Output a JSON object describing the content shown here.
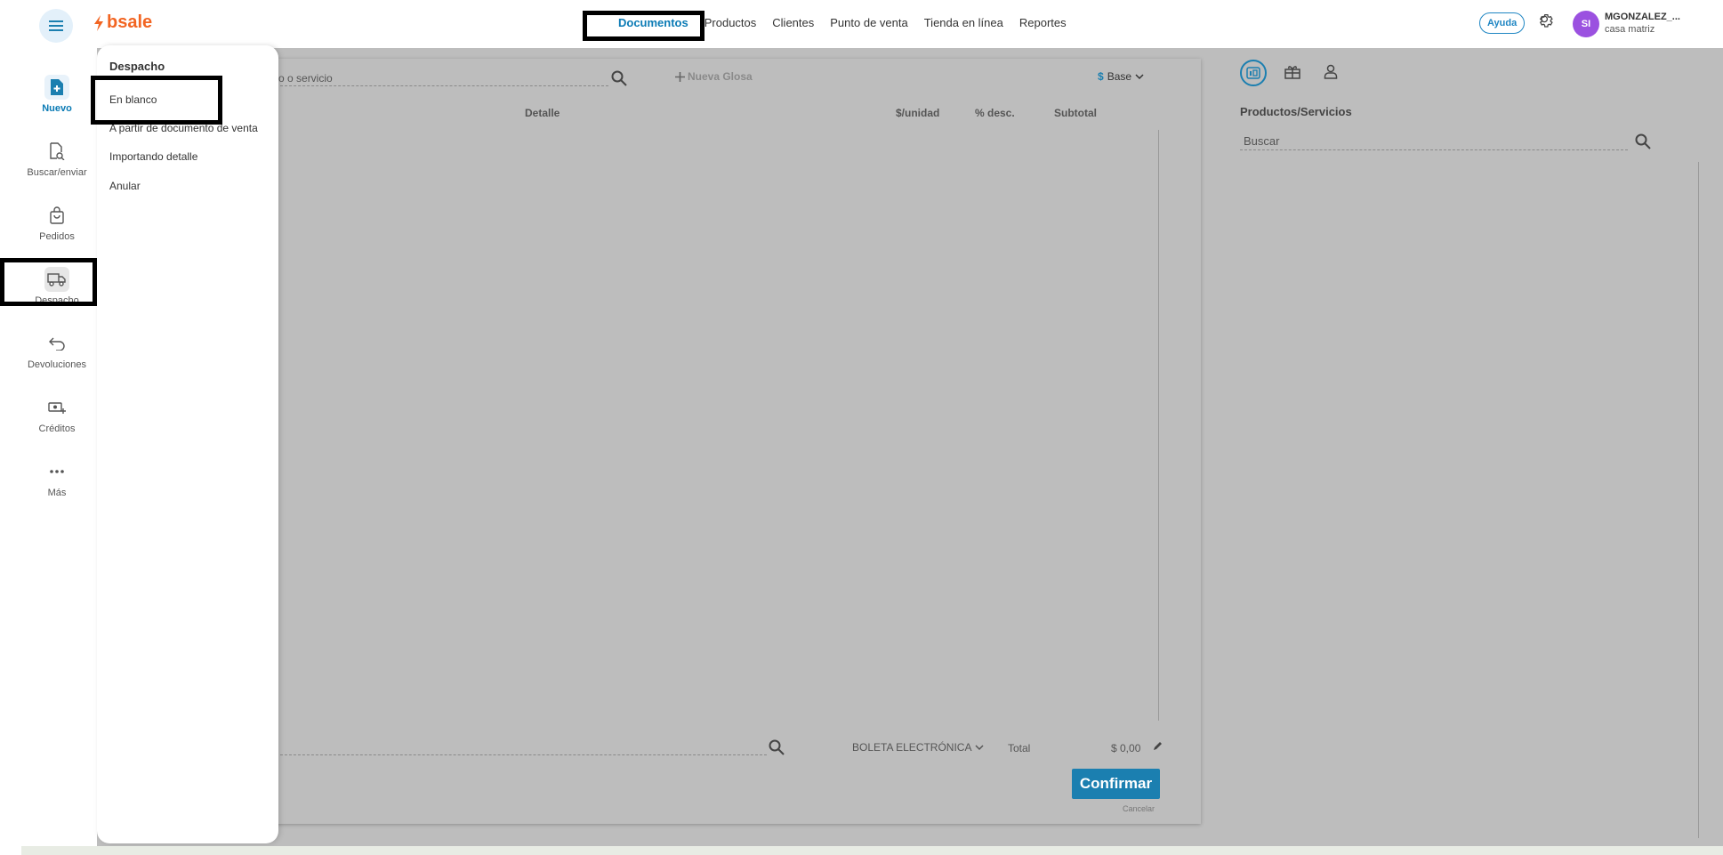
{
  "header": {
    "logo_text": "bsale",
    "nav": [
      "Documentos",
      "Productos",
      "Clientes",
      "Punto de venta",
      "Tienda en línea",
      "Reportes"
    ],
    "help_label": "Ayuda",
    "avatar_initials": "SI",
    "user_name": "MGONZALEZ_...",
    "user_branch": "casa matriz"
  },
  "sidebar": {
    "items": [
      {
        "label": "Nuevo",
        "icon": "new-document-icon"
      },
      {
        "label": "Buscar/enviar",
        "icon": "search-document-icon"
      },
      {
        "label": "Pedidos",
        "icon": "bag-icon"
      },
      {
        "label": "Despacho",
        "icon": "truck-icon"
      },
      {
        "label": "Devoluciones",
        "icon": "return-arrow-icon"
      },
      {
        "label": "Créditos",
        "icon": "money-plus-icon"
      },
      {
        "label": "Más",
        "icon": "more-dots-icon"
      }
    ]
  },
  "popup": {
    "title": "Despacho",
    "items": [
      "En blanco",
      "A partir de documento de venta",
      "Importando detalle",
      "Anular"
    ]
  },
  "document": {
    "search_placeholder_visible": "o o servicio",
    "new_gloss_label": "Nueva Glosa",
    "currency_symbol": "$",
    "price_list": "Base",
    "columns": [
      "Detalle",
      "$/unidad",
      "% desc.",
      "Subtotal"
    ],
    "doc_type": "BOLETA ELECTRÓNICA",
    "total_label": "Total",
    "total_value": "$ 0,00",
    "confirm_label": "Confirmar",
    "cancel_label": "Cancelar"
  },
  "right_panel": {
    "title": "Productos/Servicios",
    "search_placeholder": "Buscar"
  },
  "colors": {
    "brand_orange": "#f26522",
    "accent_blue": "#0b7bb5",
    "avatar_purple": "#9b51e0",
    "overlay_grey": "#bdbdbd"
  }
}
